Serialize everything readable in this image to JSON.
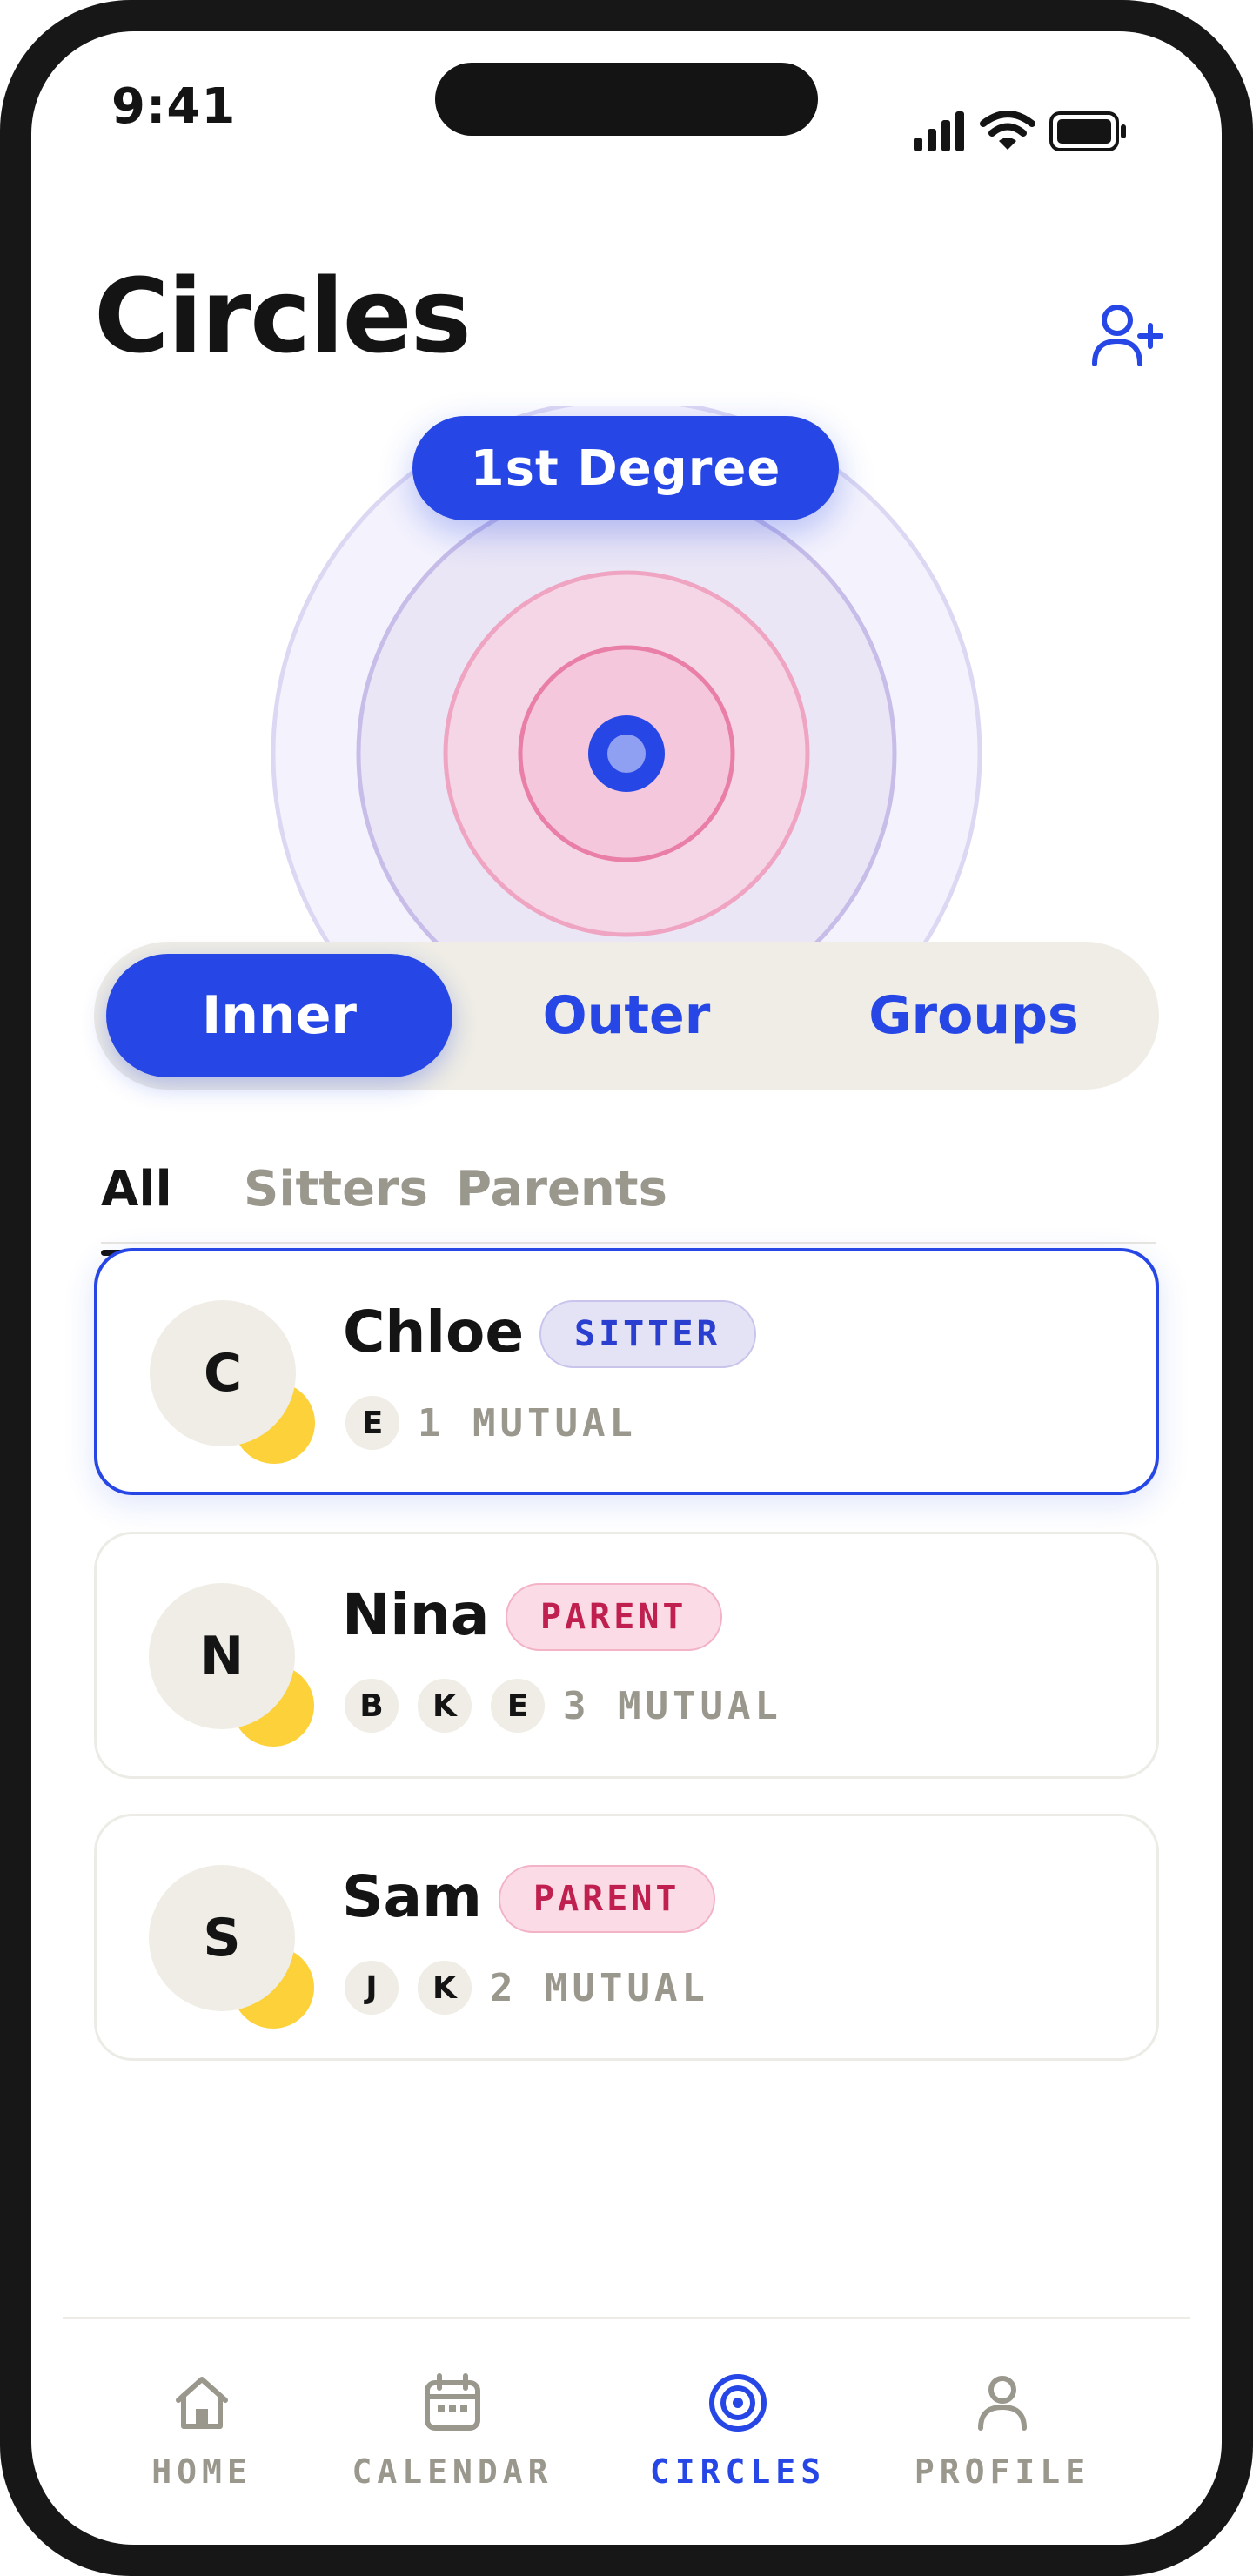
{
  "status_bar": {
    "time": "9:41"
  },
  "header": {
    "title": "Circles",
    "add_icon": "user-plus-icon"
  },
  "rings": {
    "degree_label": "1st Degree"
  },
  "segments": [
    {
      "label": "Inner",
      "active": true
    },
    {
      "label": "Outer",
      "active": false
    },
    {
      "label": "Groups",
      "active": false
    }
  ],
  "filters": [
    {
      "label": "All",
      "active": true
    },
    {
      "label": "Sitters",
      "active": false
    },
    {
      "label": "Parents",
      "active": false
    }
  ],
  "contacts": [
    {
      "initial": "C",
      "name": "Chloe",
      "role": "SITTER",
      "mutual_initials": [
        "E"
      ],
      "mutual_label": "1 MUTUAL",
      "selected": true
    },
    {
      "initial": "N",
      "name": "Nina",
      "role": "PARENT",
      "mutual_initials": [
        "B",
        "K",
        "E"
      ],
      "mutual_label": "3 MUTUAL",
      "selected": false
    },
    {
      "initial": "S",
      "name": "Sam",
      "role": "PARENT",
      "mutual_initials": [
        "J",
        "K"
      ],
      "mutual_label": "2 MUTUAL",
      "selected": false
    }
  ],
  "nav": [
    {
      "label": "HOME",
      "icon": "home-icon",
      "active": false
    },
    {
      "label": "CALENDAR",
      "icon": "calendar-icon",
      "active": false
    },
    {
      "label": "CIRCLES",
      "icon": "circles-icon",
      "active": true
    },
    {
      "label": "PROFILE",
      "icon": "profile-icon",
      "active": false
    }
  ],
  "colors": {
    "accent": "#2647e6",
    "sitter_badge": "#e4e3f6",
    "parent_badge": "#fbdbe5",
    "avatar_bg": "#efede5",
    "avatar_dot": "#fdd13a",
    "muted_text": "#9a978d"
  }
}
